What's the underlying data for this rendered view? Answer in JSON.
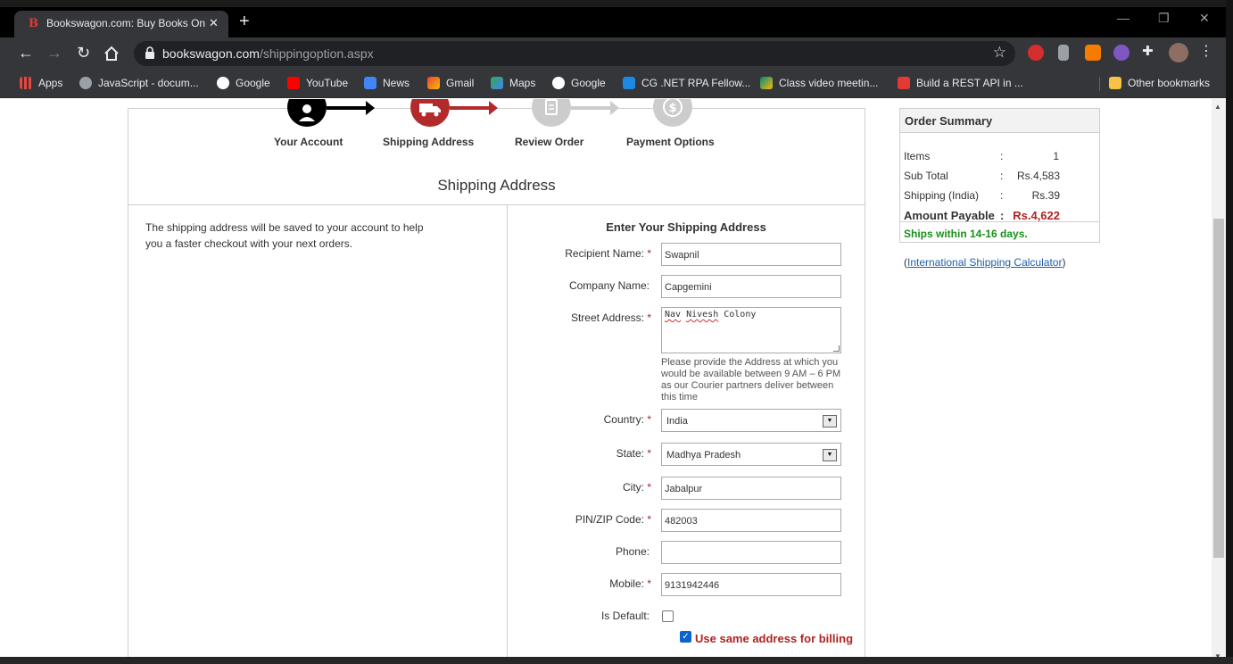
{
  "browser": {
    "tab_title": "Bookswagon.com: Buy Books Onl",
    "tab_favicon": "B",
    "url_domain": "bookswagon.com",
    "url_path": "/shippingoption.aspx",
    "window_controls": {
      "minimize": "—",
      "restore": "❐",
      "close": "✕"
    },
    "bookmarks": [
      {
        "label": "Apps",
        "icon": "apps-grid-icon",
        "color": "#e8453c"
      },
      {
        "label": "JavaScript - docum...",
        "icon": "globe-icon",
        "color": "#9aa0a6"
      },
      {
        "label": "Google",
        "icon": "google-icon",
        "color": "#ffffff"
      },
      {
        "label": "YouTube",
        "icon": "youtube-icon",
        "color": "#ff0000"
      },
      {
        "label": "News",
        "icon": "google-news-icon",
        "color": "#4285f4"
      },
      {
        "label": "Gmail",
        "icon": "gmail-icon",
        "color": "#ea4335"
      },
      {
        "label": "Maps",
        "icon": "maps-icon",
        "color": "#34a853"
      },
      {
        "label": "Google",
        "icon": "google-icon",
        "color": "#ffffff"
      },
      {
        "label": "CG .NET RPA Fellow...",
        "icon": "classroom-icon",
        "color": "#1e88e5"
      },
      {
        "label": "Class video meetin...",
        "icon": "meet-icon",
        "color": "#00897b"
      },
      {
        "label": "Build a REST API in ...",
        "icon": "document-icon",
        "color": "#e53935"
      },
      {
        "label": "Other bookmarks",
        "icon": "folder-icon",
        "color": "#f6c344"
      }
    ]
  },
  "steps": [
    {
      "label": "Your Account",
      "icon": "user-icon",
      "color": "#000000"
    },
    {
      "label": "Shipping Address",
      "icon": "truck-icon",
      "color": "#b22a2a"
    },
    {
      "label": "Review Order",
      "icon": "clipboard-icon",
      "color": "#cccccc"
    },
    {
      "label": "Payment Options",
      "icon": "dollar-icon",
      "color": "#cccccc"
    }
  ],
  "section_title": "Shipping Address",
  "info_text": "The shipping address will be saved to your account to help you a faster checkout with your next orders.",
  "form": {
    "title": "Enter Your Shipping Address",
    "required_mark": "*",
    "recipient_label": "Recipient Name:",
    "recipient_value": "Swapnil",
    "company_label": "Company Name:",
    "company_value": "Capgemini",
    "street_label": "Street Address:",
    "street_value_1": "Nav",
    "street_value_2": "Nivesh",
    "street_value_3": "Colony",
    "street_hint": "Please provide the Address at which you would be available between 9 AM – 6 PM as our Courier partners deliver between this time",
    "country_label": "Country:",
    "country_value": "India",
    "state_label": "State:",
    "state_value": "Madhya Pradesh",
    "city_label": "City:",
    "city_value": "Jabalpur",
    "pin_label": "PIN/ZIP Code:",
    "pin_value": "482003",
    "phone_label": "Phone:",
    "phone_value": "",
    "mobile_label": "Mobile:",
    "mobile_value": "9131942446",
    "default_label": "Is Default:",
    "billing_label": "Use same address for billing"
  },
  "summary": {
    "title": "Order Summary",
    "colon": ":",
    "items_label": "Items",
    "items_value": "1",
    "subtotal_label": "Sub Total",
    "subtotal_value": "Rs.4,583",
    "shipping_label": "Shipping (India)",
    "shipping_value": "Rs.39",
    "payable_label": "Amount Payable",
    "payable_value": "Rs.4,622",
    "ships_text": "Ships within 14-16 days.",
    "calc_open": "(",
    "calc_link": "International Shipping Calculator",
    "calc_close": ")"
  },
  "colors": {
    "accent_red": "#b22a2a",
    "ships_green": "#1a8f1a",
    "link_blue": "#1f5fa8"
  }
}
